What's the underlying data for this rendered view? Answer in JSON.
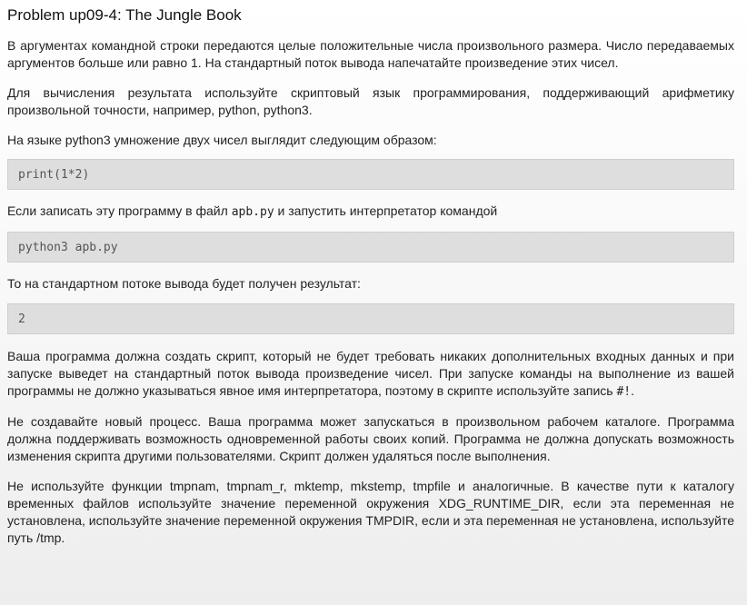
{
  "title": "Problem up09-4: The Jungle Book",
  "paragraphs": {
    "p1": "В аргументах командной строки передаются целые положительные числа произвольного размера. Число передаваемых аргументов больше или равно 1. На стандартный поток вывода напечатайте произведение этих чисел.",
    "p2": "Для вычисления результата используйте скриптовый язык программирования, поддерживающий арифметику произвольной точности, например, python, python3.",
    "p3": "На языке python3 умножение двух чисел выглядит следующим образом:",
    "p4_before": "Если записать эту программу в файл ",
    "p4_code": "apb.py",
    "p4_after": " и запустить интерпретатор командой",
    "p5": "То на стандартном потоке вывода будет получен результат:",
    "p6_before": "Ваша программа должна создать скрипт, который не будет требовать никаких дополнительных входных данных и при запуске выведет на стандартный поток вывода произведение чисел. При запуске команды на выполнение из вашей программы не должно указываться явное имя интерпретатора, поэтому в скрипте используйте запись ",
    "p6_code": "#!",
    "p6_after": ".",
    "p7": "Не создавайте новый процесс. Ваша программа может запускаться в произвольном рабочем каталоге. Программа должна поддерживать возможность одновременной работы своих копий. Программа не должна допускать возможность изменения скрипта другими пользователями. Скрипт должен удаляться после выполнения.",
    "p8": "Не используйте функции tmpnam, tmpnam_r, mktemp, mkstemp, tmpfile и аналогичные. В качестве пути к каталогу временных файлов используйте значение переменной окружения XDG_RUNTIME_DIR, если эта переменная не установлена, используйте значение переменной окружения TMPDIR, если и эта переменная не установлена, используйте путь /tmp."
  },
  "code_blocks": {
    "c1": "print(1*2)",
    "c2": "python3 apb.py",
    "c3": "2"
  }
}
